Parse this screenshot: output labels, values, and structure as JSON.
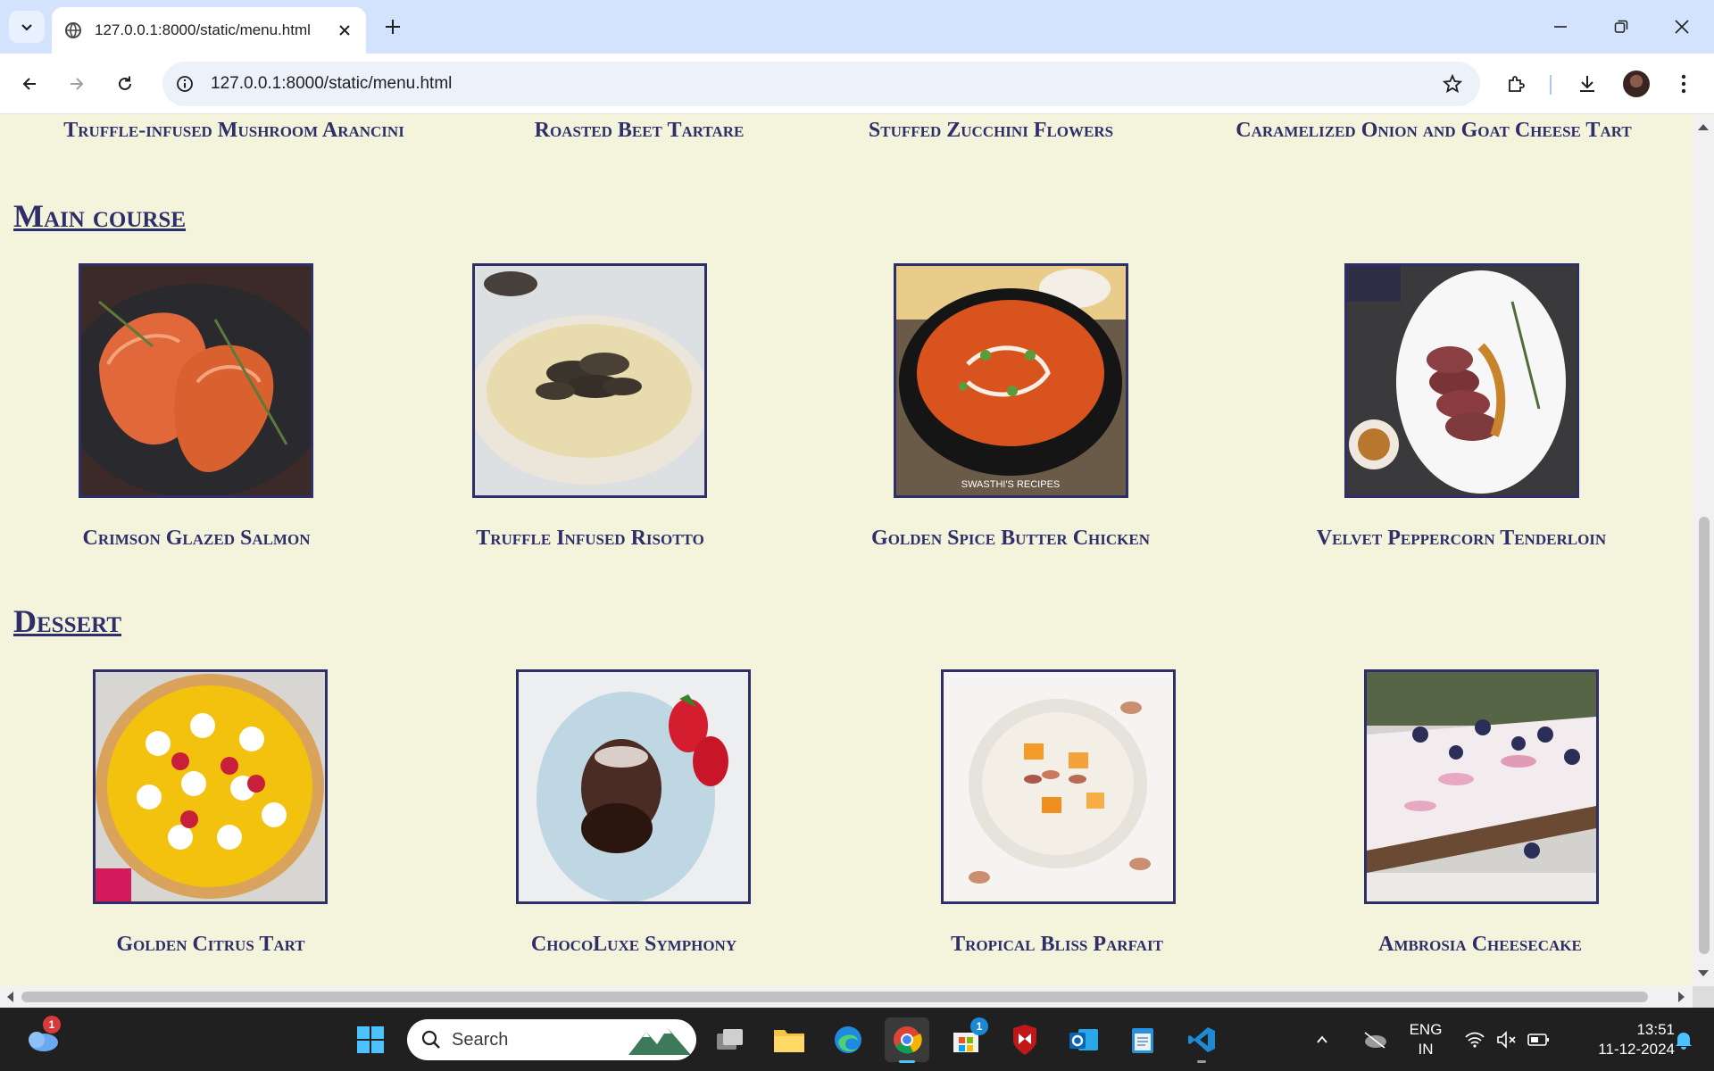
{
  "browser": {
    "tab_title": "127.0.0.1:8000/static/menu.html",
    "url": "127.0.0.1:8000/static/menu.html"
  },
  "starters_row": {
    "items": [
      "Truffle-infused Mushroom Arancini",
      "Roasted Beet Tartare",
      "Stuffed Zucchini Flowers",
      "Caramelized Onion and Goat Cheese Tart"
    ]
  },
  "main_course": {
    "heading": "Main course",
    "items": [
      {
        "name": "Crimson Glazed Salmon",
        "image": "salmon-photo"
      },
      {
        "name": "Truffle Infused Risotto",
        "image": "risotto-photo"
      },
      {
        "name": "Golden Spice Butter Chicken",
        "image": "butter-chicken-photo"
      },
      {
        "name": "Velvet Peppercorn Tenderloin",
        "image": "tenderloin-photo"
      }
    ],
    "image_watermark": "SWASTHI'S RECIPES"
  },
  "dessert": {
    "heading": "Dessert",
    "items": [
      {
        "name": "Golden Citrus Tart",
        "image": "citrus-tart-photo"
      },
      {
        "name": "ChocoLuxe Symphony",
        "image": "lava-cake-photo"
      },
      {
        "name": "Tropical Bliss Parfait",
        "image": "parfait-photo"
      },
      {
        "name": "Ambrosia Cheesecake",
        "image": "cheesecake-photo"
      }
    ]
  },
  "taskbar": {
    "search_placeholder": "Search",
    "weather_badge": "1",
    "store_badge": "1",
    "lang_line1": "ENG",
    "lang_line2": "IN",
    "time": "13:51",
    "date": "11-12-2024"
  },
  "colors": {
    "page_bg": "#f4f4dc",
    "heading": "#2e2e6b",
    "tabbar": "#d3e3fd"
  }
}
